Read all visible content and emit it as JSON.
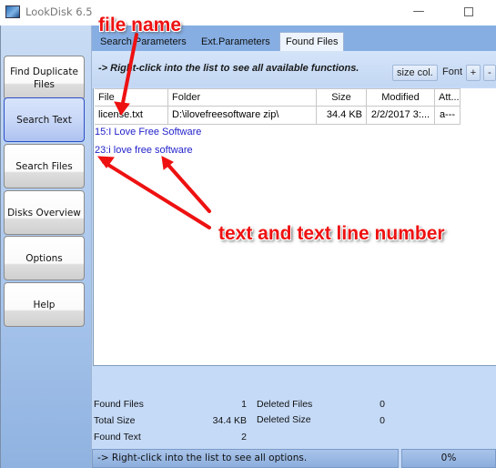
{
  "window": {
    "title": "LookDisk 6.5",
    "minimize_glyph": "—"
  },
  "sidebar": {
    "items": [
      {
        "label": "Find Duplicate Files",
        "active": false
      },
      {
        "label": "Search Text",
        "active": true
      },
      {
        "label": "Search Files",
        "active": false
      },
      {
        "label": "Disks Overview",
        "active": false
      },
      {
        "label": "Options",
        "active": false
      },
      {
        "label": "Help",
        "active": false
      }
    ]
  },
  "tabs": [
    {
      "label": "Search Parameters"
    },
    {
      "label": "Ext.Parameters"
    },
    {
      "label": "Found Files",
      "active": true
    }
  ],
  "infobar": {
    "hint": "-> Right-click into the list to see all available functions.",
    "size_col_label": "size col.",
    "font_label": "Font",
    "plus_label": "+",
    "minus_label": "-"
  },
  "list": {
    "columns": [
      "File",
      "Folder",
      "Size",
      "Modified",
      "Att..."
    ],
    "rows": [
      {
        "file": "license.txt",
        "folder": "D:\\ilovefreesoftware zip\\",
        "size": "34.4 KB",
        "modified": "2/2/2017 3:...",
        "att": "a---"
      }
    ],
    "text_hits": [
      "15:I Love Free Software",
      "23:i love free software"
    ]
  },
  "stats": {
    "found_files_label": "Found Files",
    "found_files": "1",
    "total_size_label": "Total Size",
    "total_size": "34.4 KB",
    "found_text_label": "Found Text",
    "found_text": "2",
    "deleted_files_label": "Deleted Files",
    "deleted_files": "0",
    "deleted_size_label": "Deleted Size",
    "deleted_size": "0"
  },
  "statusbar": {
    "message": "-> Right-click into the list to see all options.",
    "progress": "0%"
  },
  "annotations": {
    "file_name": "file name",
    "text_line": "text and text line number",
    "color": "#ee1111"
  }
}
